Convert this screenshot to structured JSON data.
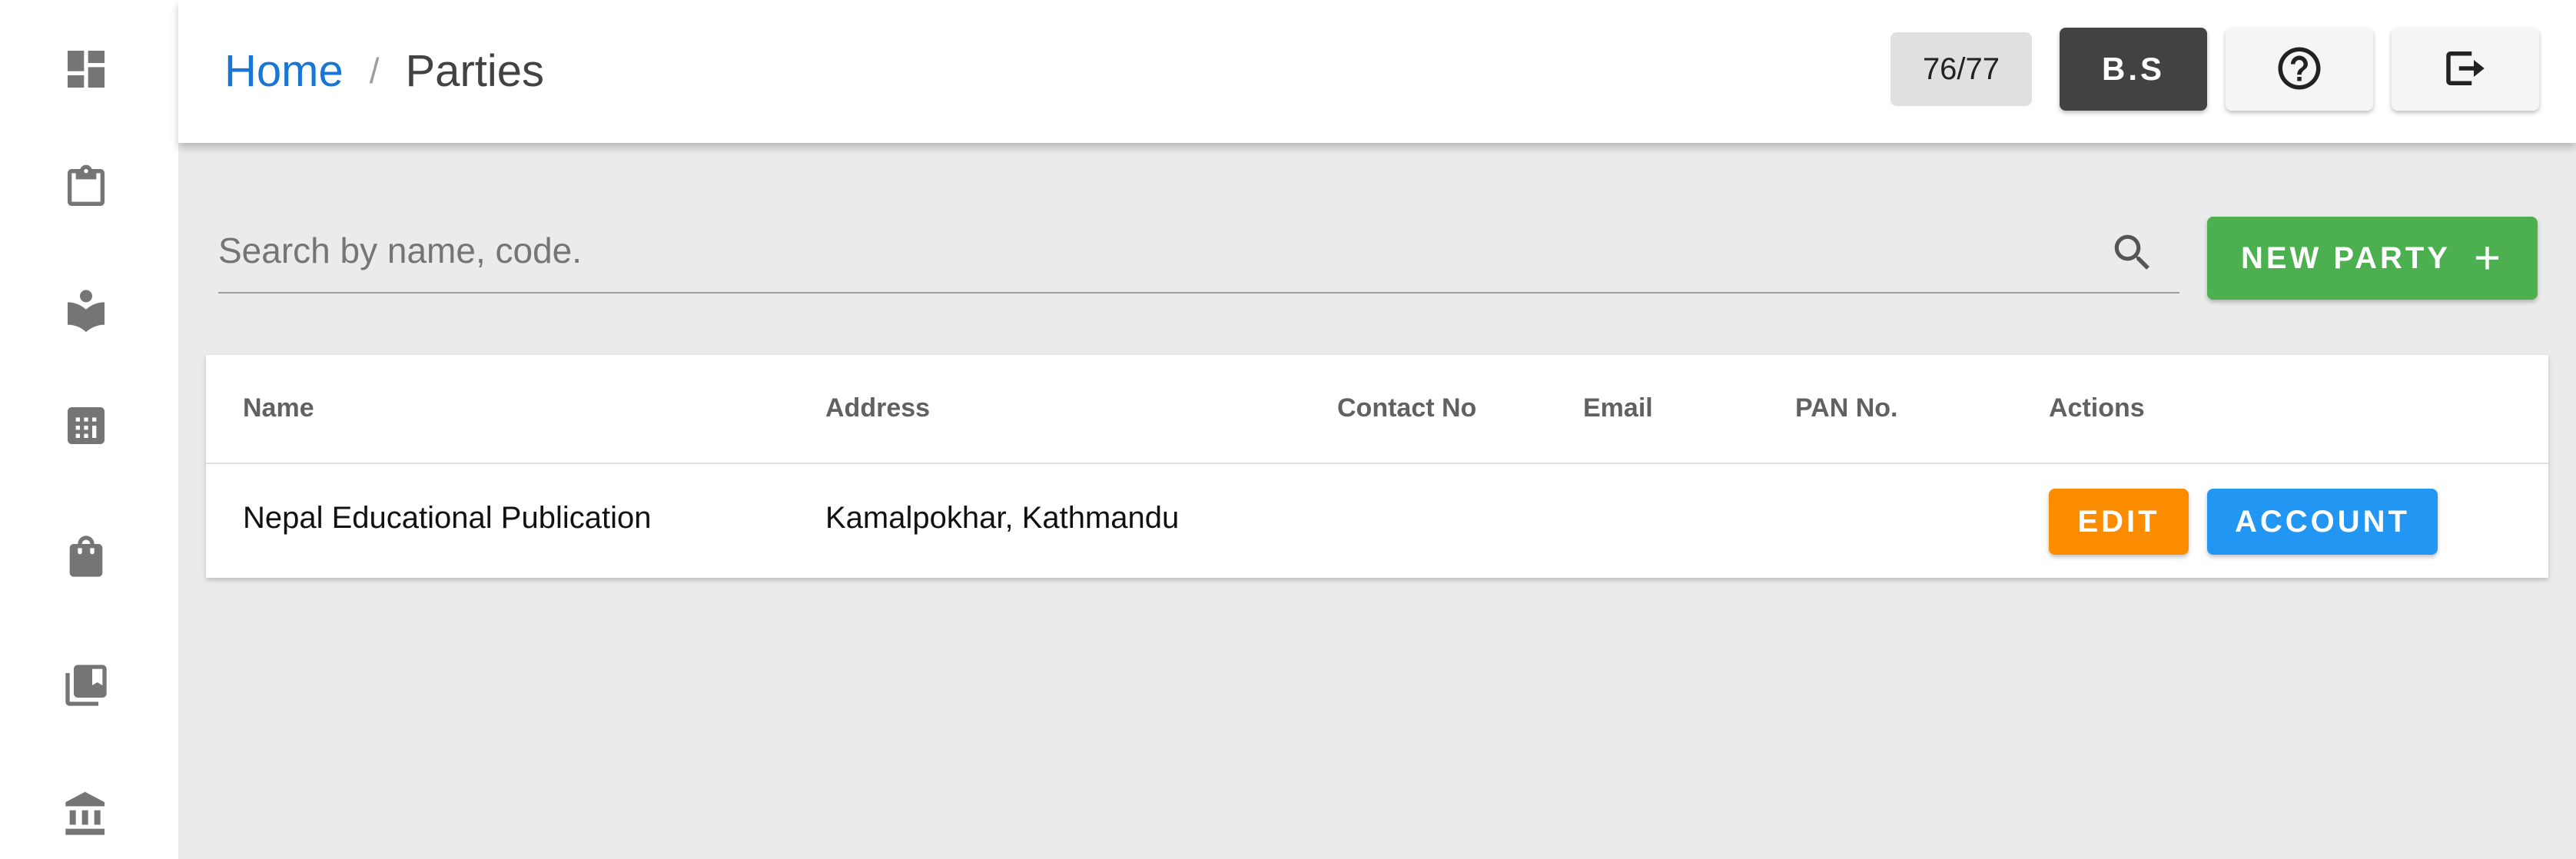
{
  "sidebar": {
    "items": [
      {
        "icon": "dashboard-icon"
      },
      {
        "icon": "clipboard-icon"
      },
      {
        "icon": "reading-book-icon"
      },
      {
        "icon": "calculator-icon"
      },
      {
        "icon": "shopping-bag-icon"
      },
      {
        "icon": "books-icon"
      },
      {
        "icon": "bank-icon"
      }
    ]
  },
  "header": {
    "breadcrumb": {
      "home": "Home",
      "separator": "/",
      "current": "Parties"
    },
    "counter": "76/77",
    "bs_button": "B.S",
    "help_icon": "help-circle-icon",
    "logout_icon": "logout-icon"
  },
  "search": {
    "placeholder": "Search by name, code.",
    "value": ""
  },
  "new_party_button": {
    "label": "NEW PARTY",
    "plus": "+"
  },
  "table": {
    "headers": [
      "Name",
      "Address",
      "Contact No",
      "Email",
      "PAN No.",
      "Actions"
    ],
    "rows": [
      {
        "name": "Nepal Educational Publication",
        "address": "Kamalpokhar, Kathmandu",
        "contact": "",
        "email": "",
        "pan": "",
        "edit_label": "EDIT",
        "account_label": "ACCOUNT"
      }
    ]
  },
  "colors": {
    "link": "#1976d2",
    "new_party": "#4caf50",
    "edit": "#fb8c00",
    "account": "#2196f3",
    "bs": "#424242"
  }
}
